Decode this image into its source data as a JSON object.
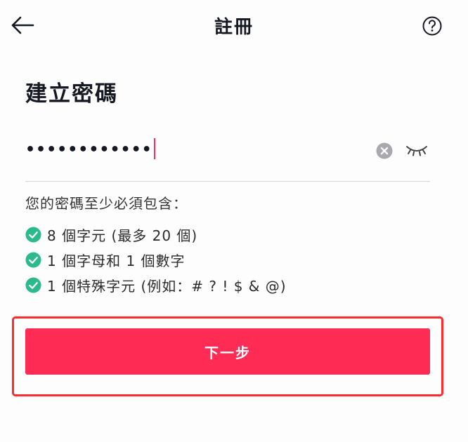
{
  "header": {
    "title": "註冊",
    "back_icon": "arrow-left-icon",
    "help_icon": "question-circle-icon"
  },
  "form": {
    "heading": "建立密碼",
    "password_masked": "••••••••••••",
    "clear_icon": "clear-circle-icon",
    "visibility_icon": "eye-closed-icon"
  },
  "requirements": {
    "title": "您的密碼至少必須包含：",
    "items": [
      {
        "text": "8 個字元 (最多 20 個)",
        "met": true
      },
      {
        "text": "1 個字母和 1 個數字",
        "met": true
      },
      {
        "text": "1 個特殊字元 (例如：# ? ! $ & @)",
        "met": true
      }
    ]
  },
  "actions": {
    "next_label": "下一步"
  },
  "colors": {
    "accent": "#fe2c55",
    "check": "#2bba8c",
    "highlight": "#ff2a2a"
  }
}
